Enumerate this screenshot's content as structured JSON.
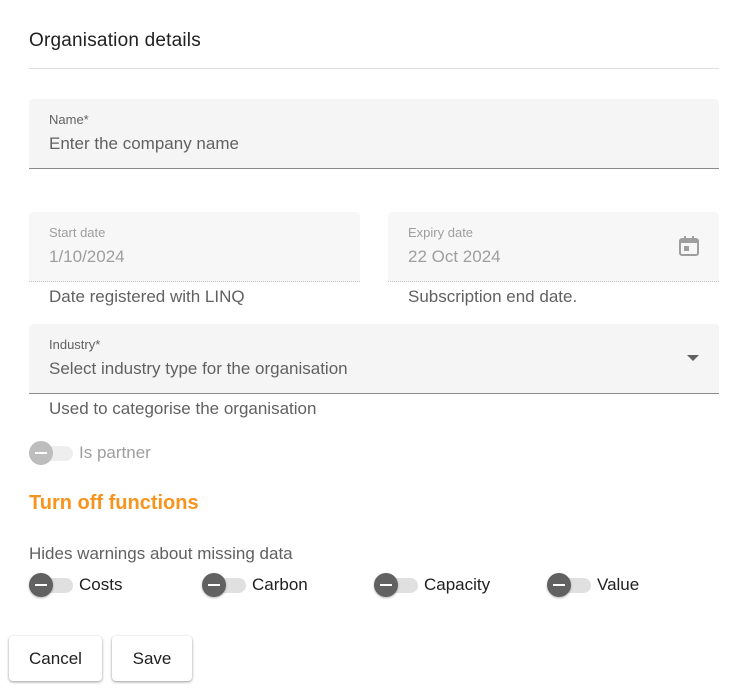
{
  "header": {
    "title": "Organisation details"
  },
  "name_field": {
    "label": "Name*",
    "placeholder": "Enter the company name"
  },
  "start_date": {
    "label": "Start date",
    "value": "1/10/2024",
    "hint": "Date registered with LINQ"
  },
  "expiry_date": {
    "label": "Expiry date",
    "value": "22 Oct 2024",
    "hint": "Subscription end date.",
    "icon": "calendar-icon"
  },
  "industry": {
    "label": "Industry*",
    "placeholder": "Select industry type for the organisation",
    "hint": "Used to categorise the organisation",
    "icon": "dropdown-arrow-icon"
  },
  "partner_toggle": {
    "label": "Is partner",
    "state": "indeterminate",
    "disabled": true
  },
  "functions": {
    "title": "Turn off functions",
    "description": "Hides warnings about missing data",
    "toggles": [
      {
        "label": "Costs",
        "state": "indeterminate"
      },
      {
        "label": "Carbon",
        "state": "indeterminate"
      },
      {
        "label": "Capacity",
        "state": "indeterminate"
      },
      {
        "label": "Value",
        "state": "indeterminate"
      }
    ]
  },
  "actions": {
    "cancel_label": "Cancel",
    "save_label": "Save"
  },
  "colors": {
    "accent": "#f7941d",
    "field_background": "#f5f5f5",
    "toggle_thumb": "#616161"
  }
}
